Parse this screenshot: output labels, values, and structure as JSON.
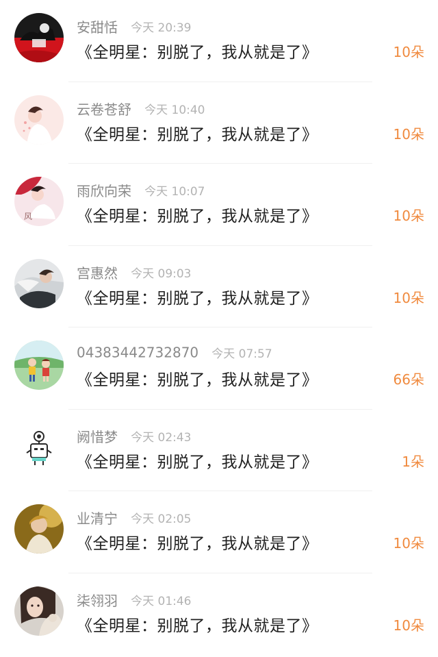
{
  "rows": [
    {
      "name": "安甜恬",
      "time": "今天 20:39",
      "gift": "《全明星：别脱了，我从就是了》",
      "count": "10朵",
      "avatar_icon": "user-avatar-red"
    },
    {
      "name": "云卷苍舒",
      "time": "今天 10:40",
      "gift": "《全明星：别脱了，我从就是了》",
      "count": "10朵",
      "avatar_icon": "user-avatar-illustration-girl"
    },
    {
      "name": "雨欣向荣",
      "time": "今天 10:07",
      "gift": "《全明星：别脱了，我从就是了》",
      "count": "10朵",
      "avatar_icon": "user-avatar-illustration-feng"
    },
    {
      "name": "宫惠然",
      "time": "今天 09:03",
      "gift": "《全明星：别脱了，我从就是了》",
      "count": "10朵",
      "avatar_icon": "user-avatar-photo-boy"
    },
    {
      "name": "04383442732870",
      "time": "今天 07:57",
      "gift": "《全明星：别脱了，我从就是了》",
      "count": "66朵",
      "avatar_icon": "user-avatar-cartoon-kids"
    },
    {
      "name": "阙惜梦",
      "time": "今天 02:43",
      "gift": "《全明星：别脱了，我从就是了》",
      "count": "1朵",
      "avatar_icon": "user-avatar-robot"
    },
    {
      "name": "业清宁",
      "time": "今天 02:05",
      "gift": "《全明星：别脱了，我从就是了》",
      "count": "10朵",
      "avatar_icon": "user-avatar-photo-child"
    },
    {
      "name": "柒翎羽",
      "time": "今天 01:46",
      "gift": "《全明星：别脱了，我从就是了》",
      "count": "10朵",
      "avatar_icon": "user-avatar-photo-girl"
    }
  ],
  "colors": {
    "accent": "#f08a3e",
    "name": "#8a8a8a",
    "time": "#b3b3b3",
    "gift": "#1f1f1f"
  }
}
